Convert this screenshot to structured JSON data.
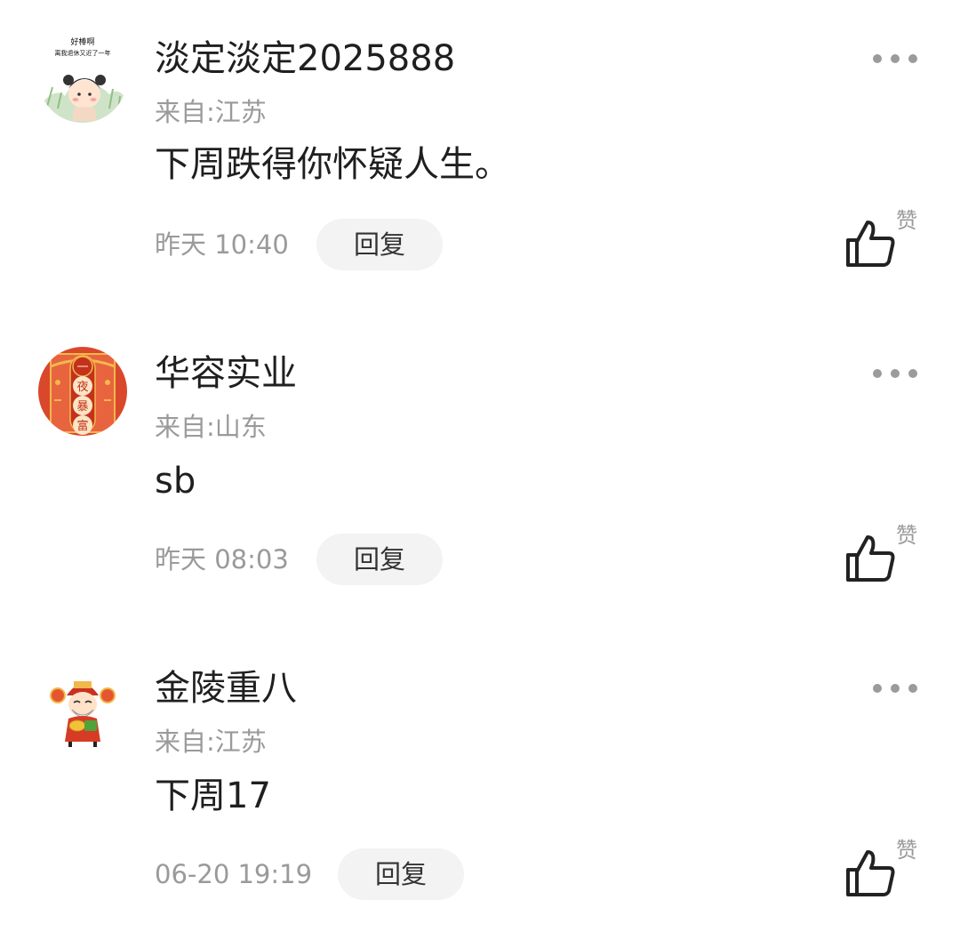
{
  "comments": [
    {
      "username": "淡定淡定2025888",
      "location": "来自:江苏",
      "text": "下周跌得你怀疑人生。",
      "time": "昨天 10:40",
      "reply_label": "回复",
      "like_label": "赞",
      "avatar_lettering": "好棒啊 离我退休又近了一年"
    },
    {
      "username": "华容实业",
      "location": "来自:山东",
      "text": "sb",
      "time": "昨天 08:03",
      "reply_label": "回复",
      "like_label": "赞",
      "avatar_lettering": "一夜暴富"
    },
    {
      "username": "金陵重八",
      "location": "来自:江苏",
      "text": "下周17",
      "time": "06-20 19:19",
      "reply_label": "回复",
      "like_label": "赞",
      "avatar_lettering": ""
    }
  ],
  "icons": {
    "more": "more-dots-icon",
    "like": "thumbs-up-icon"
  },
  "colors": {
    "secondary_text": "#9a9a9a",
    "reply_bg": "#f3f3f3",
    "avatar2_red": "#d9482b",
    "avatar2_gold": "#f2b84b"
  }
}
